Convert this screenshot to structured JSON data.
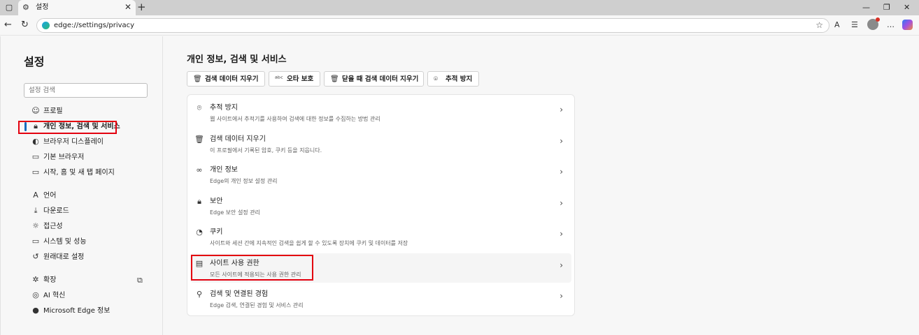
{
  "tab": {
    "title": "설정"
  },
  "omnibox": {
    "url": "edge://settings/privacy"
  },
  "sidebar": {
    "title": "설정",
    "search_placeholder": "설정 검색",
    "items": [
      {
        "label": "프로필",
        "icon": "profile-icon"
      },
      {
        "label": "개인 정보, 검색 및 서비스",
        "icon": "lock-icon",
        "active": true
      },
      {
        "label": "브라우저 디스플레이",
        "icon": "palette-icon"
      },
      {
        "label": "기본 브라우저",
        "icon": "browser-icon"
      },
      {
        "label": "시작, 홈 및 새 탭 페이지",
        "icon": "home-icon"
      },
      {
        "label": "언어",
        "icon": "language-icon"
      },
      {
        "label": "다운로드",
        "icon": "download-icon"
      },
      {
        "label": "접근성",
        "icon": "accessibility-icon"
      },
      {
        "label": "시스템 및 성능",
        "icon": "system-icon"
      },
      {
        "label": "원래대로 설정",
        "icon": "reset-icon"
      },
      {
        "label": "확장",
        "icon": "extension-icon"
      },
      {
        "label": "AI 혁신",
        "icon": "ai-icon"
      },
      {
        "label": "Microsoft Edge 정보",
        "icon": "edge-logo-icon"
      }
    ]
  },
  "main": {
    "title": "개인 정보, 검색 및 서비스",
    "chips": [
      {
        "label": "검색 데이터 지우기",
        "icon": "trash-icon"
      },
      {
        "label": "오타 보호",
        "icon": "spellcheck-icon"
      },
      {
        "label": "닫을 때 검색 데이터 지우기",
        "icon": "trash-clock-icon"
      },
      {
        "label": "추적 방지",
        "icon": "tracking-icon"
      }
    ],
    "rows": [
      {
        "title": "추적 방지",
        "desc": "웹 사이트에서 추적기를 사용하여 검색에 대한 정보를 수집하는 방법 관리",
        "icon": "tracking-icon"
      },
      {
        "title": "검색 데이터 지우기",
        "desc": "이 프로필에서 기록된 암호, 쿠키 등을 지웁니다.",
        "icon": "trash-icon"
      },
      {
        "title": "개인 정보",
        "desc": "Edge의 개인 정보 설정 관리",
        "icon": "glasses-icon"
      },
      {
        "title": "보안",
        "desc": "Edge 보안 설정 관리",
        "icon": "lock-icon"
      },
      {
        "title": "쿠키",
        "desc": "사이트와 세션 간에 지속적인 검색을 쉽게 할 수 있도록 장치에 쿠키 및 데이터를 저장",
        "icon": "cookie-icon"
      },
      {
        "title": "사이트 사용 권한",
        "desc": "모든 사이트에 적용되는 사용 권한 관리",
        "icon": "site-permissions-icon"
      },
      {
        "title": "검색 및 연결된 경험",
        "desc": "Edge 검색, 연결된 경험 및 서비스 관리",
        "icon": "search-icon"
      }
    ]
  }
}
